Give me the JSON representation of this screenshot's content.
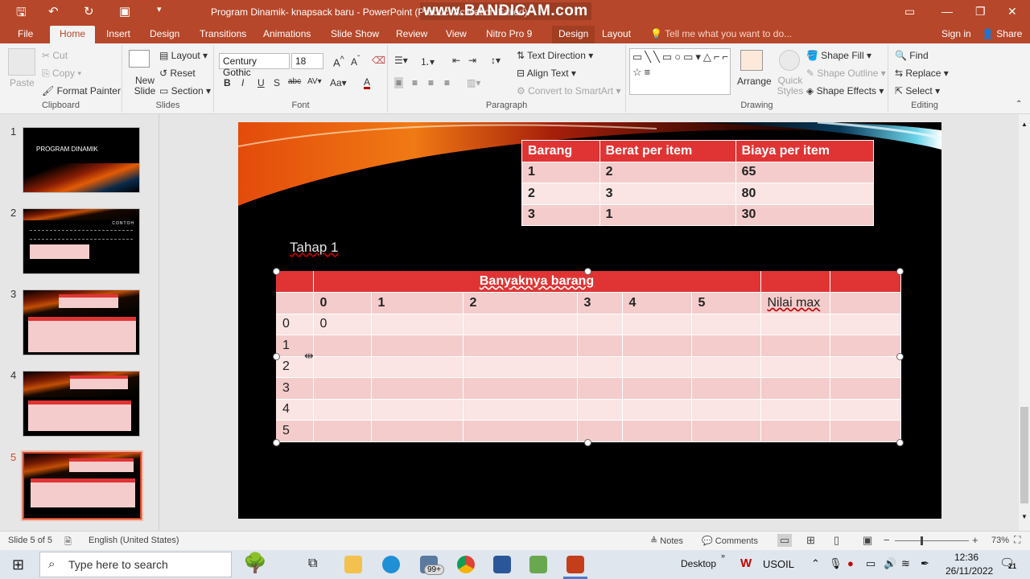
{
  "title_bar": {
    "title": "Program Dinamik- knapsack baru  -  PowerPoint (Product Activation Failed)",
    "watermark": "www.BANDICAM.com"
  },
  "tabs": [
    "File",
    "Home",
    "Insert",
    "Design",
    "Transitions",
    "Animations",
    "Slide Show",
    "Review",
    "View",
    "Nitro Pro 9",
    "Design",
    "Layout"
  ],
  "tell_me": "Tell me what you want to do...",
  "sign_in": "Sign in",
  "share": "Share",
  "ribbon": {
    "clipboard": {
      "label": "Clipboard",
      "paste": "Paste",
      "cut": "Cut",
      "copy": "Copy",
      "format_painter": "Format Painter"
    },
    "slides": {
      "label": "Slides",
      "new_slide": "New Slide",
      "layout": "Layout",
      "reset": "Reset",
      "section": "Section"
    },
    "font": {
      "label": "Font",
      "name": "Century Gothic",
      "size": "18"
    },
    "paragraph": {
      "label": "Paragraph",
      "text_direction": "Text Direction",
      "align_text": "Align Text",
      "convert_smartart": "Convert to SmartArt"
    },
    "drawing": {
      "label": "Drawing",
      "arrange": "Arrange",
      "quick_styles": "Quick Styles",
      "shape_fill": "Shape Fill",
      "shape_outline": "Shape Outline",
      "shape_effects": "Shape Effects"
    },
    "editing": {
      "label": "Editing",
      "find": "Find",
      "replace": "Replace",
      "select": "Select"
    }
  },
  "thumbnails": [
    {
      "num": "1",
      "title": "PROGRAM DINAMIK"
    },
    {
      "num": "2",
      "title": "CONTOH"
    },
    {
      "num": "3",
      "title": ""
    },
    {
      "num": "4",
      "title": ""
    },
    {
      "num": "5",
      "title": ""
    }
  ],
  "slide": {
    "stage_label": "Tahap 1",
    "top_table": {
      "headers": [
        "Barang",
        "Berat per item",
        "Biaya per item"
      ],
      "rows": [
        [
          "1",
          "2",
          "65"
        ],
        [
          "2",
          "3",
          "80"
        ],
        [
          "3",
          "1",
          "30"
        ]
      ]
    },
    "main_table": {
      "header": "Banyaknya barang",
      "columns": [
        "",
        "0",
        "1",
        "2",
        "3",
        "4",
        "5",
        "Nilai max",
        ""
      ],
      "rows": [
        [
          "0",
          "0",
          "",
          "",
          "",
          "",
          "",
          "",
          ""
        ],
        [
          "1",
          "",
          "",
          "",
          "",
          "",
          "",
          "",
          ""
        ],
        [
          "2",
          "",
          "",
          "",
          "",
          "",
          "",
          "",
          ""
        ],
        [
          "3",
          "",
          "",
          "",
          "",
          "",
          "",
          "",
          ""
        ],
        [
          "4",
          "",
          "",
          "",
          "",
          "",
          "",
          "",
          ""
        ],
        [
          "5",
          "",
          "",
          "",
          "",
          "",
          "",
          "",
          ""
        ]
      ]
    }
  },
  "status": {
    "slide_info": "Slide 5 of 5",
    "language": "English (United States)",
    "notes": "Notes",
    "comments": "Comments",
    "zoom": "73%"
  },
  "taskbar": {
    "search_placeholder": "Type here to search",
    "mail_badge": "99+",
    "desktop": "Desktop",
    "usoil": "USOIL",
    "time": "12:36",
    "date": "26/11/2022",
    "notif_count": "21"
  },
  "colors": {
    "accent": "#b7472a",
    "table_header": "#e03434",
    "row_light": "#f4cccc",
    "row_lighter": "#fae4e4"
  }
}
